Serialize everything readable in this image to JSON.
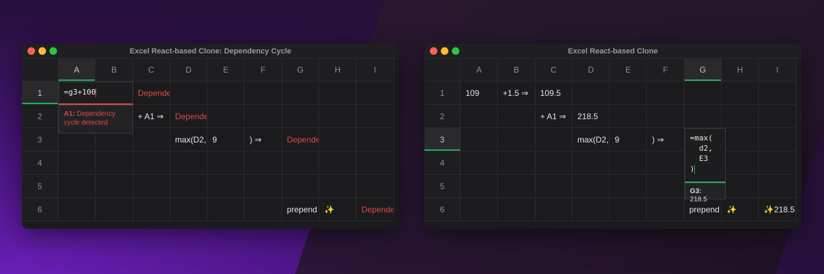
{
  "left": {
    "title": "Excel React-based Clone: Dependency Cycle",
    "columns": [
      "A",
      "B",
      "C",
      "D",
      "E",
      "F",
      "G",
      "H",
      "I"
    ],
    "rows": [
      "1",
      "2",
      "3",
      "4",
      "5",
      "6"
    ],
    "editor_value": "=g3+100",
    "tooltip": {
      "cell": "A1:",
      "message": "Dependency cycle detected"
    },
    "cells": {
      "C1": "Dependency cycle detected",
      "C2": "+ A1 ⇒",
      "D2": "Dependency cycle detected",
      "D3": "max(D2,",
      "E3": "9",
      "F3": ") ⇒",
      "G3": "Dependency cycle detected",
      "G6": "prepend",
      "H6": "✨",
      "I6": "Dependency cycle detected"
    }
  },
  "right": {
    "title": "Excel React-based Clone",
    "columns": [
      "A",
      "B",
      "C",
      "D",
      "E",
      "F",
      "G",
      "H",
      "I"
    ],
    "rows": [
      "1",
      "2",
      "3",
      "4",
      "5",
      "6"
    ],
    "editor_lines": [
      "=max(",
      "  d2,",
      "  E3",
      ")"
    ],
    "tooltip": {
      "cell": "G3:",
      "value": "218.5"
    },
    "cells": {
      "A1": "109",
      "B1": "+1.5 ⇒",
      "C1": "109.5",
      "C2": "+ A1 ⇒",
      "D2": "218.5",
      "D3": "max(D2,",
      "E3": "9",
      "F3": ") ⇒",
      "G6": "prepend",
      "H6": "✨",
      "I6": "✨218.5"
    }
  }
}
